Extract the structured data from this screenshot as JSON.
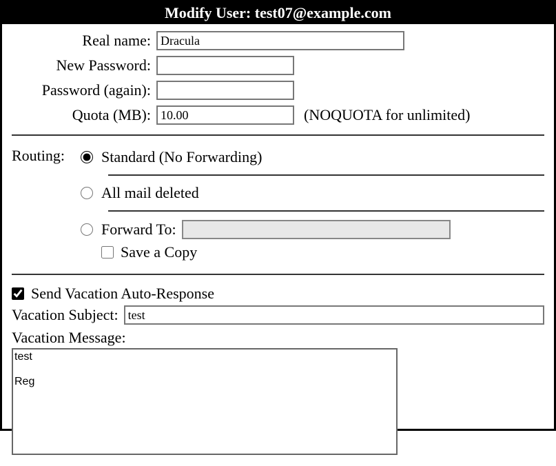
{
  "title": "Modify User: test07@example.com",
  "labels": {
    "real_name": "Real name:",
    "new_password": "New Password:",
    "password_again": "Password (again):",
    "quota": "Quota (MB):",
    "quota_hint": "(NOQUOTA for unlimited)",
    "routing": "Routing:",
    "standard": "Standard (No Forwarding)",
    "all_deleted": "All mail deleted",
    "forward_to": "Forward To:",
    "save_copy": "Save a Copy",
    "send_vacation": "Send Vacation Auto-Response",
    "vac_subject": "Vacation Subject:",
    "vac_message": "Vacation Message:"
  },
  "values": {
    "real_name": "Dracula",
    "new_password": "",
    "password_again": "",
    "quota": "10.00",
    "forward_to": "",
    "vac_subject": "test",
    "vac_message": "test\n\nReg"
  },
  "routing_selected": "standard",
  "save_copy_checked": false,
  "send_vacation_checked": true
}
